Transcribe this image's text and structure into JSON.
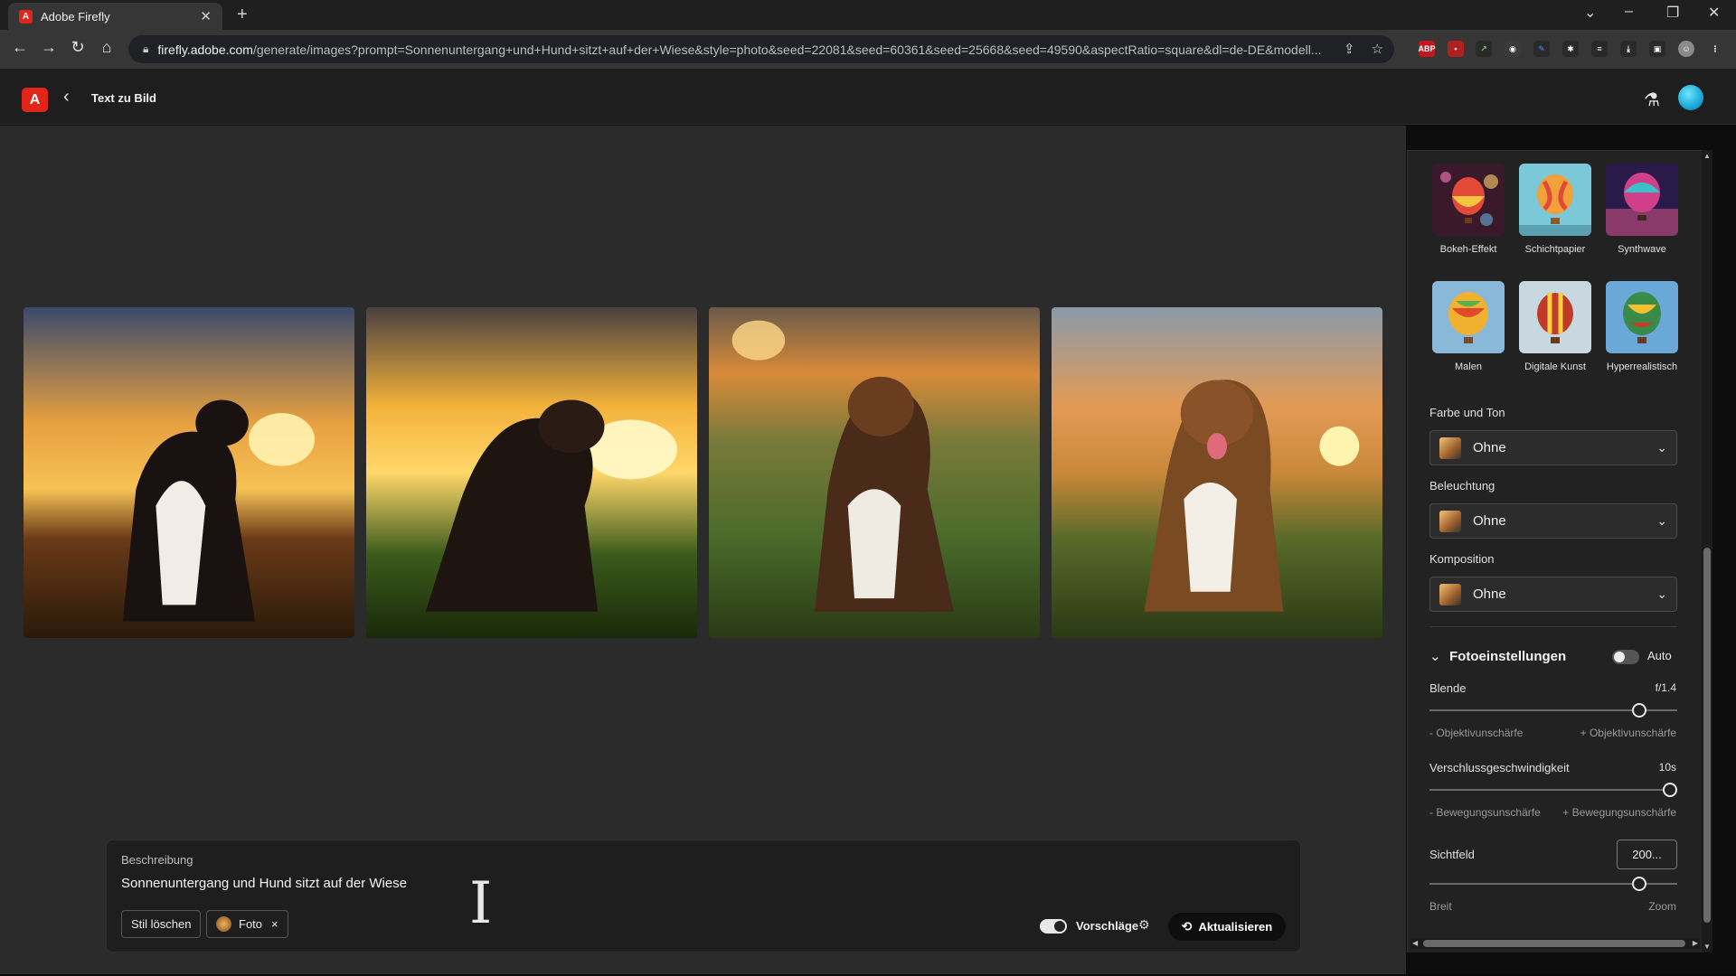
{
  "browser": {
    "tab_title": "Adobe Firefly",
    "url_host": "firefly.adobe.com",
    "url_path": "/generate/images?prompt=Sonnenuntergang+und+Hund+sitzt+auf+der+Wiese&style=photo&seed=22081&seed=60361&seed=25668&seed=49590&aspectRatio=square&dl=de-DE&modell...",
    "ext_abp": "ABP"
  },
  "app": {
    "logo_letter": "A",
    "back_glyph": "‹",
    "title": "Text zu Bild"
  },
  "images": [
    {
      "name": "image-1",
      "sky": "#e8a040"
    },
    {
      "name": "image-2",
      "sky": "#f3b23a"
    },
    {
      "name": "image-3",
      "sky": "#d98a3a"
    },
    {
      "name": "image-4",
      "sky": "#e39a55"
    }
  ],
  "styles": [
    {
      "label": "Bokeh-Effekt"
    },
    {
      "label": "Schichtpapier"
    },
    {
      "label": "Synthwave"
    },
    {
      "label": "Malen"
    },
    {
      "label": "Digitale Kunst"
    },
    {
      "label": "Hyperrealistisch"
    }
  ],
  "panel": {
    "farbe_label": "Farbe und Ton",
    "farbe_value": "Ohne",
    "beleuchtung_label": "Beleuchtung",
    "beleuchtung_value": "Ohne",
    "komposition_label": "Komposition",
    "komposition_value": "Ohne",
    "foto_label": "Fotoeinstellungen",
    "auto_label": "Auto",
    "auto_on": false,
    "blende_label": "Blende",
    "blende_value": "f/1.4",
    "blende_min": "- Objektivunschärfe",
    "blende_max": "+ Objektivunschärfe",
    "blende_level": 0.87,
    "verschluss_label": "Verschlussgeschwindigkeit",
    "verschluss_value": "10s",
    "verschluss_min": "- Bewegungsunschärfe",
    "verschluss_max": "+ Bewegungsunschärfe",
    "verschluss_level": 1.0,
    "sichtfeld_label": "Sichtfeld",
    "sichtfeld_value": "200...",
    "sichtfeld_min": "Breit",
    "sichtfeld_max": "Zoom",
    "sichtfeld_level": 0.87
  },
  "prompt": {
    "label": "Beschreibung",
    "text": "Sonnenuntergang und Hund sitzt auf der Wiese",
    "clear_style": "Stil löschen",
    "chip_label": "Foto",
    "chip_close": "×",
    "suggestions_label": "Vorschläge",
    "suggestions_on": true,
    "refresh_label": "Aktualisieren"
  },
  "colors": {
    "accent": "#e1251b",
    "toggle_on": "#ffffff"
  }
}
